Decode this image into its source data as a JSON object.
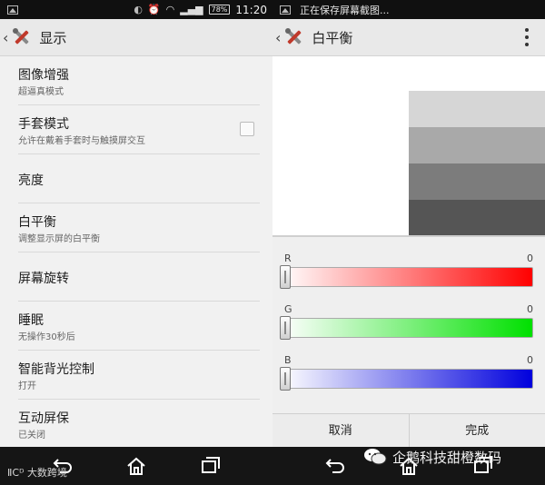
{
  "left": {
    "status": {
      "battery": "78%",
      "time": "11:20"
    },
    "actionbar": {
      "title": "显示"
    },
    "items": [
      {
        "title": "图像增强",
        "sub": "超逼真模式"
      },
      {
        "title": "手套模式",
        "sub": "允许在戴着手套时与触摸屏交互",
        "checkbox": false
      },
      {
        "title": "亮度",
        "sub": ""
      },
      {
        "title": "白平衡",
        "sub": "调整显示屏的白平衡"
      },
      {
        "title": "屏幕旋转",
        "sub": ""
      },
      {
        "title": "睡眠",
        "sub": "无操作30秒后"
      },
      {
        "title": "智能背光控制",
        "sub": "打开"
      },
      {
        "title": "互动屏保",
        "sub": "已关闭"
      }
    ],
    "watermark": "大数跨境"
  },
  "right": {
    "status": {
      "notice": "正在保存屏幕截图..."
    },
    "actionbar": {
      "title": "白平衡"
    },
    "preview": {
      "background": "#ffffff",
      "swatches": [
        "#d6d6d6",
        "#a9a9a9",
        "#7c7c7c",
        "#555555"
      ]
    },
    "sliders": [
      {
        "label": "R",
        "value": "0",
        "color": "#ff0000"
      },
      {
        "label": "G",
        "value": "0",
        "color": "#00e000"
      },
      {
        "label": "B",
        "value": "0",
        "color": "#0000dd"
      }
    ],
    "buttons": {
      "cancel": "取消",
      "done": "完成"
    },
    "watermark": "企鹅科技甜橙数码"
  }
}
